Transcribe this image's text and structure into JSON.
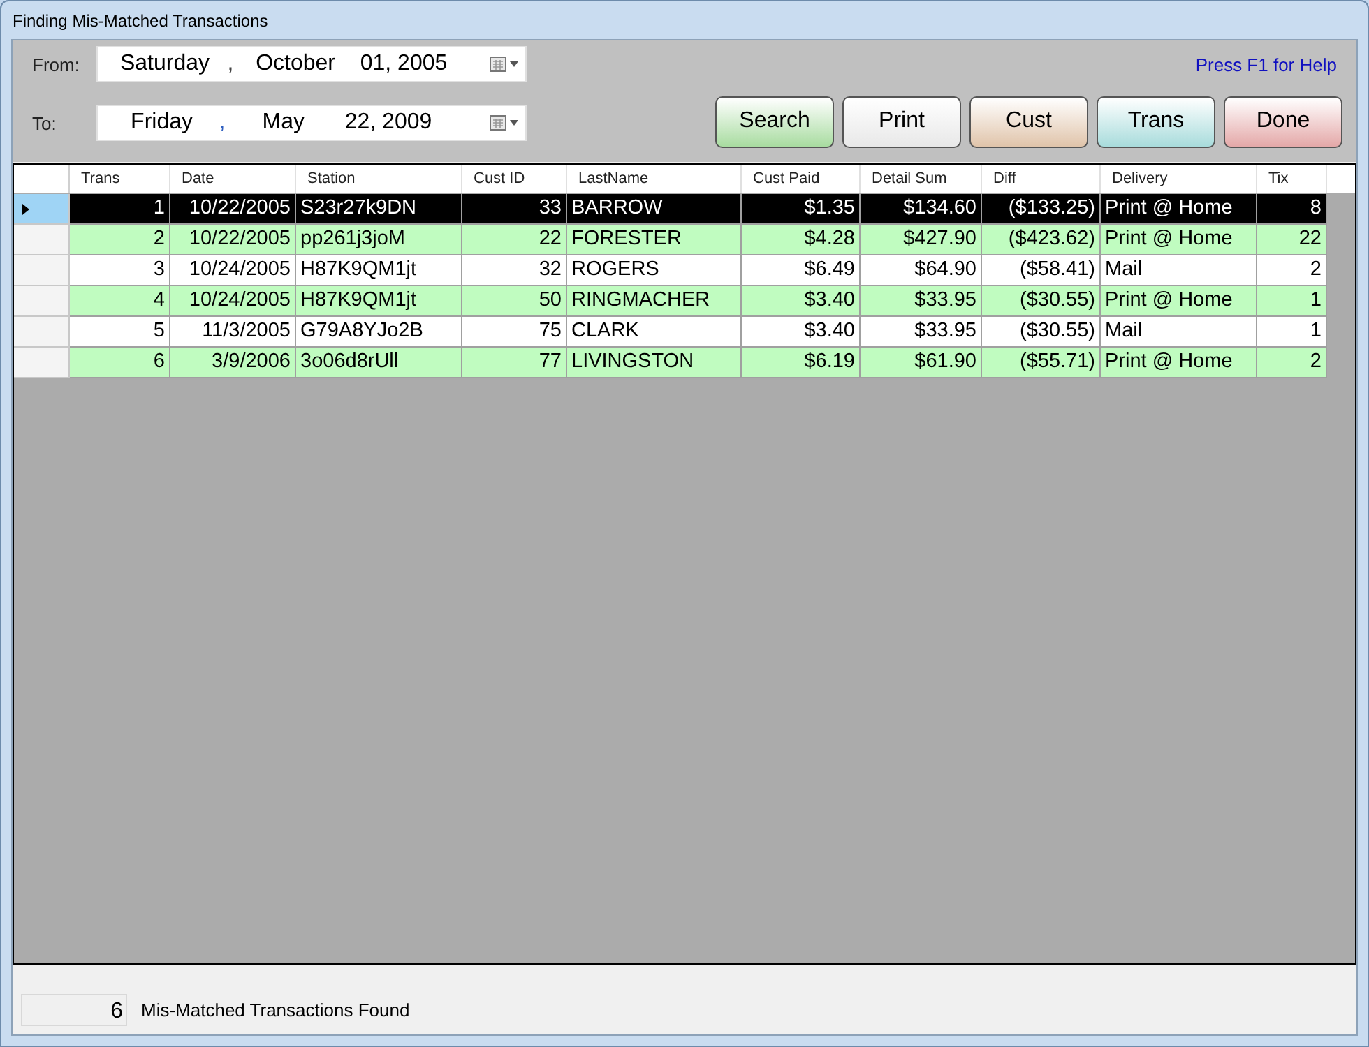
{
  "window": {
    "title": "Finding Mis-Matched Transactions"
  },
  "from": {
    "label": "From:",
    "weekday": "Saturday",
    "separator": ",",
    "month": "October",
    "day_year": "01, 2005"
  },
  "to": {
    "label": "To:",
    "weekday": "Friday",
    "separator": ",",
    "month": "May",
    "day_year": "22, 2009"
  },
  "help_text": "Press F1 for Help",
  "buttons": [
    {
      "label": "Search",
      "color": "#a8dca0"
    },
    {
      "label": "Print",
      "color": "#e8e8e8"
    },
    {
      "label": "Cust",
      "color": "#e0c4aa"
    },
    {
      "label": "Trans",
      "color": "#a8dcdc"
    },
    {
      "label": "Done",
      "color": "#e4a8a8"
    }
  ],
  "table": {
    "columns": [
      {
        "label": "Trans"
      },
      {
        "label": "Date"
      },
      {
        "label": "Station"
      },
      {
        "label": "Cust ID"
      },
      {
        "label": "LastName"
      },
      {
        "label": "Cust Paid"
      },
      {
        "label": "Detail Sum"
      },
      {
        "label": "Diff"
      },
      {
        "label": "Delivery"
      },
      {
        "label": "Tix"
      }
    ],
    "rows": [
      {
        "selected": true,
        "cells": [
          "1",
          "10/22/2005",
          "S23r27k9DN",
          "33",
          "BARROW",
          "$1.35",
          "$134.60",
          "($133.25)",
          "Print @ Home",
          "8"
        ]
      },
      {
        "selected": false,
        "cells": [
          "2",
          "10/22/2005",
          "pp261j3joM",
          "22",
          "FORESTER",
          "$4.28",
          "$427.90",
          "($423.62)",
          "Print @ Home",
          "22"
        ]
      },
      {
        "selected": false,
        "cells": [
          "3",
          "10/24/2005",
          "H87K9QM1jt",
          "32",
          "ROGERS",
          "$6.49",
          "$64.90",
          "($58.41)",
          "Mail",
          "2"
        ]
      },
      {
        "selected": false,
        "cells": [
          "4",
          "10/24/2005",
          "H87K9QM1jt",
          "50",
          "RINGMACHER",
          "$3.40",
          "$33.95",
          "($30.55)",
          "Print @ Home",
          "1"
        ]
      },
      {
        "selected": false,
        "cells": [
          "5",
          "11/3/2005",
          "G79A8YJo2B",
          "75",
          "CLARK",
          "$3.40",
          "$33.95",
          "($30.55)",
          "Mail",
          "1"
        ]
      },
      {
        "selected": false,
        "cells": [
          "6",
          "3/9/2006",
          "3o06d8rUll",
          "77",
          "LIVINGSTON",
          "$6.19",
          "$61.90",
          "($55.71)",
          "Print @ Home",
          "2"
        ]
      }
    ]
  },
  "status": {
    "count": "6",
    "label": "Mis-Matched Transactions Found"
  }
}
